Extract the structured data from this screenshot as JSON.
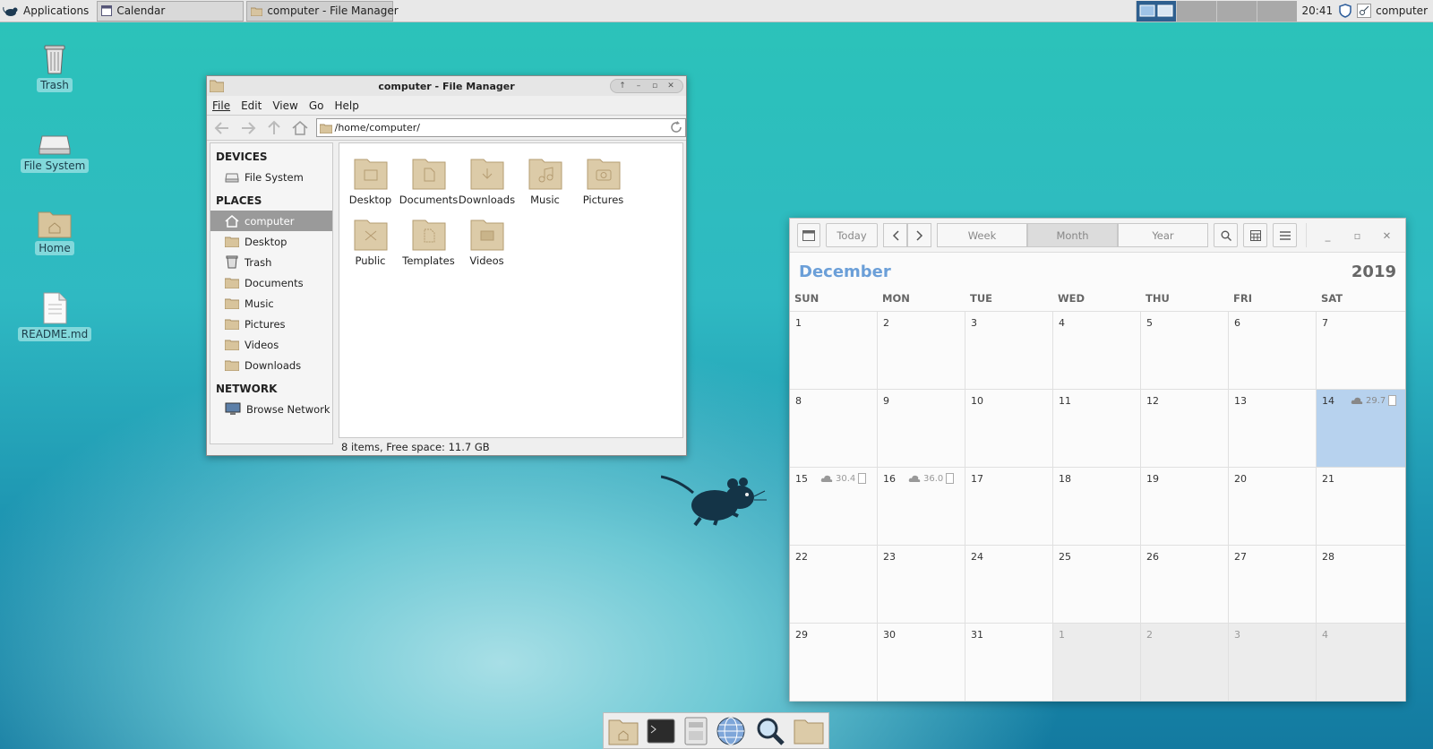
{
  "top_panel": {
    "applications_label": "Applications",
    "tasks": [
      {
        "label": "Calendar",
        "icon": "calendar-icon"
      },
      {
        "label": "computer - File Manager",
        "icon": "folder-icon"
      }
    ],
    "clock": "20:41",
    "user": "computer"
  },
  "desktop": {
    "icons": [
      {
        "label": "Trash",
        "icon": "trash-icon"
      },
      {
        "label": "File System",
        "icon": "drive-icon"
      },
      {
        "label": "Home",
        "icon": "home-folder-icon"
      },
      {
        "label": "README.md",
        "icon": "document-icon"
      }
    ]
  },
  "file_manager": {
    "title": "computer - File Manager",
    "menu": [
      "File",
      "Edit",
      "View",
      "Go",
      "Help"
    ],
    "location": "/home/computer/",
    "sidebar": {
      "devices_header": "DEVICES",
      "devices": [
        "File System"
      ],
      "places_header": "PLACES",
      "places": [
        "computer",
        "Desktop",
        "Trash",
        "Documents",
        "Music",
        "Pictures",
        "Videos",
        "Downloads"
      ],
      "selected_place": "computer",
      "network_header": "NETWORK",
      "network": [
        "Browse Network"
      ]
    },
    "files": [
      "Desktop",
      "Documents",
      "Downloads",
      "Music",
      "Pictures",
      "Public",
      "Templates",
      "Videos"
    ],
    "status": "8 items, Free space: 11.7 GB"
  },
  "calendar": {
    "today_label": "Today",
    "views": [
      "Week",
      "Month",
      "Year"
    ],
    "active_view": "Month",
    "month": "December",
    "year": "2019",
    "weekdays": [
      "SUN",
      "MON",
      "TUE",
      "WED",
      "THU",
      "FRI",
      "SAT"
    ],
    "weeks": [
      [
        "1",
        "2",
        "3",
        "4",
        "5",
        "6",
        "7"
      ],
      [
        "8",
        "9",
        "10",
        "11",
        "12",
        "13",
        "14"
      ],
      [
        "15",
        "16",
        "17",
        "18",
        "19",
        "20",
        "21"
      ],
      [
        "22",
        "23",
        "24",
        "25",
        "26",
        "27",
        "28"
      ],
      [
        "29",
        "30",
        "31",
        "1",
        "2",
        "3",
        "4"
      ]
    ],
    "today": "14",
    "weather": {
      "14": "29.7",
      "15": "30.4",
      "16": "36.0"
    },
    "accent_color": "#6b9fd8",
    "today_color": "#b7d2ee"
  },
  "dock": {
    "items": [
      "home-folder-icon",
      "terminal-icon",
      "file-manager-icon",
      "web-browser-icon",
      "search-icon",
      "folder-icon"
    ]
  }
}
